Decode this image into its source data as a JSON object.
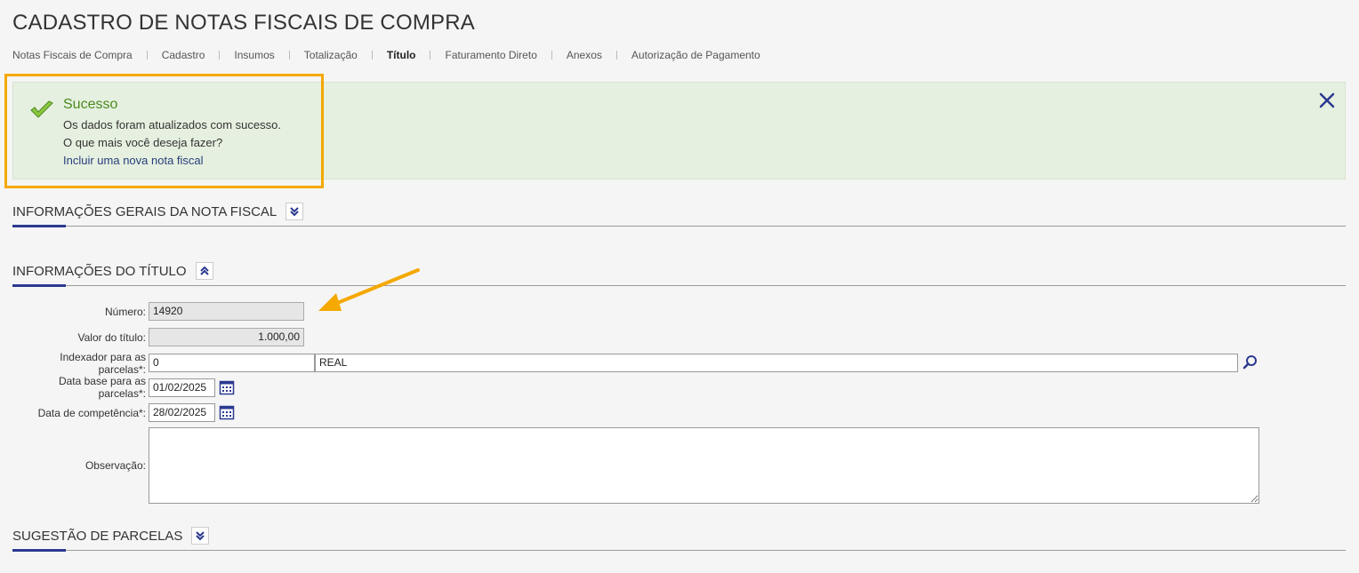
{
  "page": {
    "title": "CADASTRO DE NOTAS FISCAIS DE COMPRA"
  },
  "subnav": [
    {
      "label": "Notas Fiscais de Compra"
    },
    {
      "label": "Cadastro"
    },
    {
      "label": "Insumos"
    },
    {
      "label": "Totalização"
    },
    {
      "label": "Título",
      "active": true
    },
    {
      "label": "Faturamento Direto"
    },
    {
      "label": "Anexos"
    },
    {
      "label": "Autorização de Pagamento"
    }
  ],
  "alert": {
    "title": "Sucesso",
    "message": "Os dados foram atualizados com sucesso.",
    "question": "O que mais você deseja fazer?",
    "link": "Incluir uma nova nota fiscal",
    "icon": "check-icon",
    "close_icon": "close-icon"
  },
  "sections": {
    "general": {
      "title": "INFORMAÇÕES GERAIS DA NOTA FISCAL",
      "state": "collapsed"
    },
    "titulo": {
      "title": "INFORMAÇÕES DO TÍTULO",
      "state": "expanded"
    },
    "parcelas": {
      "title": "SUGESTÃO DE PARCELAS",
      "state": "collapsed"
    }
  },
  "form": {
    "numero": {
      "label": "Número:",
      "value": "14920"
    },
    "valor": {
      "label": "Valor do título:",
      "value": "1.000,00"
    },
    "indexador": {
      "label": "Indexador para as parcelas*:",
      "code": "0",
      "name": "REAL"
    },
    "data_base": {
      "label": "Data base para as parcelas*:",
      "value": "01/02/2025"
    },
    "data_comp": {
      "label": "Data de competência*:",
      "value": "28/02/2025"
    },
    "observacao": {
      "label": "Observação:",
      "value": ""
    }
  },
  "colors": {
    "accent": "#2b3990",
    "success": "#4b8a1e",
    "highlight": "#f5a800",
    "alert_bg": "#e6f0e0"
  }
}
